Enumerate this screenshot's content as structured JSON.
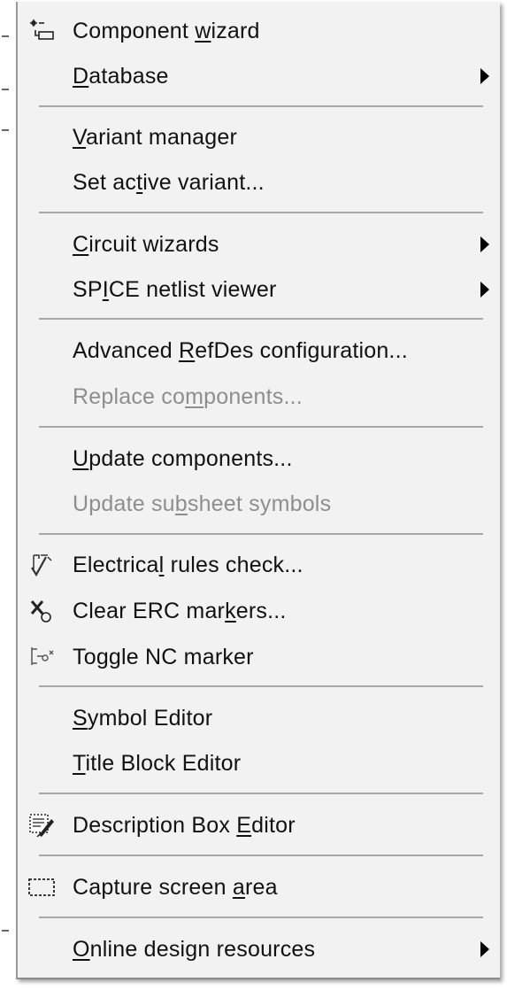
{
  "menu": {
    "items": [
      {
        "id": "component-wizard",
        "before": "Component ",
        "key": "w",
        "after": "izard",
        "disabled": false,
        "submenu": false,
        "icon": "component-wizard-icon"
      },
      {
        "id": "database",
        "before": "",
        "key": "D",
        "after": "atabase",
        "disabled": false,
        "submenu": true,
        "icon": ""
      },
      {
        "id": "variant-manager",
        "before": "",
        "key": "V",
        "after": "ariant manager",
        "disabled": false,
        "submenu": false,
        "icon": ""
      },
      {
        "id": "set-active-variant",
        "before": "Set ac",
        "key": "t",
        "after": "ive variant...",
        "disabled": false,
        "submenu": false,
        "icon": ""
      },
      {
        "id": "circuit-wizards",
        "before": "",
        "key": "C",
        "after": "ircuit wizards",
        "disabled": false,
        "submenu": true,
        "icon": ""
      },
      {
        "id": "spice-netlist-viewer",
        "before": "SP",
        "key": "I",
        "after": "CE netlist viewer",
        "disabled": false,
        "submenu": true,
        "icon": ""
      },
      {
        "id": "advanced-refdes-configuration",
        "before": "Advanced ",
        "key": "R",
        "after": "efDes configuration...",
        "disabled": false,
        "submenu": false,
        "icon": ""
      },
      {
        "id": "replace-components",
        "before": "Replace co",
        "key": "m",
        "after": "ponents...",
        "disabled": true,
        "submenu": false,
        "icon": ""
      },
      {
        "id": "update-components",
        "before": "",
        "key": "U",
        "after": "pdate components...",
        "disabled": false,
        "submenu": false,
        "icon": ""
      },
      {
        "id": "update-subsheet-symbols",
        "before": "Update su",
        "key": "b",
        "after": "sheet symbols",
        "disabled": true,
        "submenu": false,
        "icon": ""
      },
      {
        "id": "electrical-rules-check",
        "before": "Electrica",
        "key": "l",
        "after": " rules check...",
        "disabled": false,
        "submenu": false,
        "icon": "electrical-rules-check-icon"
      },
      {
        "id": "clear-erc-markers",
        "before": "Clear ERC mar",
        "key": "k",
        "after": "ers...",
        "disabled": false,
        "submenu": false,
        "icon": "clear-erc-markers-icon"
      },
      {
        "id": "toggle-nc-marker",
        "before": "To",
        "key": "g",
        "after": "gle NC marker",
        "disabled": false,
        "submenu": false,
        "icon": "toggle-nc-marker-icon"
      },
      {
        "id": "symbol-editor",
        "before": "",
        "key": "S",
        "after": "ymbol Editor",
        "disabled": false,
        "submenu": false,
        "icon": ""
      },
      {
        "id": "title-block-editor",
        "before": "",
        "key": "T",
        "after": "itle Block Editor",
        "disabled": false,
        "submenu": false,
        "icon": ""
      },
      {
        "id": "description-box-editor",
        "before": "Description Box ",
        "key": "E",
        "after": "ditor",
        "disabled": false,
        "submenu": false,
        "icon": "description-box-editor-icon"
      },
      {
        "id": "capture-screen-area",
        "before": "Capture screen ",
        "key": "a",
        "after": "rea",
        "disabled": false,
        "submenu": false,
        "icon": "capture-screen-area-icon"
      },
      {
        "id": "online-design-resources",
        "before": "",
        "key": "O",
        "after": "nline design resources",
        "disabled": false,
        "submenu": true,
        "icon": ""
      }
    ]
  }
}
